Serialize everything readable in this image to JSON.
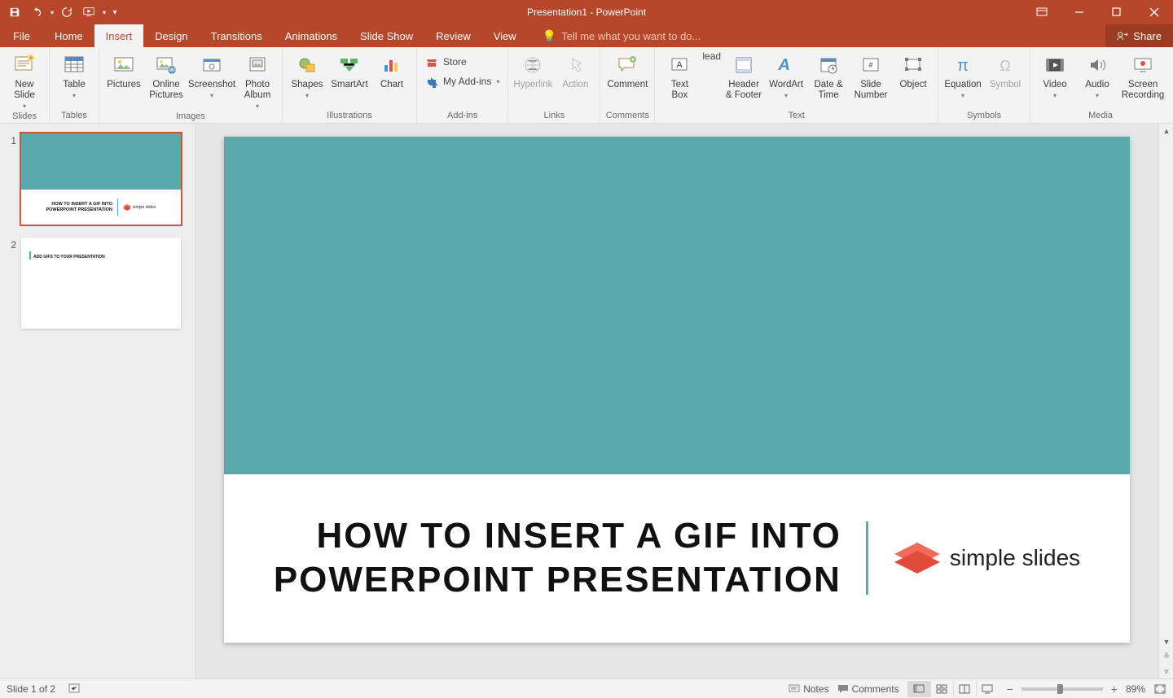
{
  "titlebar": {
    "title": "Presentation1 - PowerPoint"
  },
  "menu_tabs": {
    "file": "File",
    "home": "Home",
    "insert": "Insert",
    "design": "Design",
    "transitions": "Transitions",
    "animations": "Animations",
    "slideshow": "Slide Show",
    "review": "Review",
    "view": "View",
    "tellme": "Tell me what you want to do...",
    "share": "Share"
  },
  "ribbon": {
    "groups": {
      "slides": "Slides",
      "tables": "Tables",
      "images": "Images",
      "illustrations": "Illustrations",
      "addins": "Add-ins",
      "links": "Links",
      "comments": "Comments",
      "text": "Text",
      "symbols": "Symbols",
      "media": "Media"
    },
    "buttons": {
      "new_slide": "New\nSlide",
      "table": "Table",
      "pictures": "Pictures",
      "online_pictures": "Online\nPictures",
      "screenshot": "Screenshot",
      "photo_album": "Photo\nAlbum",
      "shapes": "Shapes",
      "smartart": "SmartArt",
      "chart": "Chart",
      "store": "Store",
      "my_addins": "My Add-ins",
      "hyperlink": "Hyperlink",
      "action": "Action",
      "comment": "Comment",
      "text_box": "Text\nBox",
      "header_footer": "Header\n& Footer",
      "wordart": "WordArt",
      "date_time": "Date &\nTime",
      "slide_number": "Slide\nNumber",
      "object": "Object",
      "equation": "Equation",
      "symbol": "Symbol",
      "video": "Video",
      "audio": "Audio",
      "screen_recording": "Screen\nRecording"
    }
  },
  "thumbs": {
    "n1": "1",
    "n2": "2",
    "thumb1_title": "HOW TO INSERT A GIF INTO\nPOWERPOINT PRESENTATION",
    "thumb1_logo": "simple slides",
    "thumb2_title": "ADD GIFS TO YOUR PRESENTATION"
  },
  "slide": {
    "title_l1": "HOW TO INSERT A GIF INTO",
    "title_l2": "POWERPOINT PRESENTATION",
    "logo_text": "simple slides"
  },
  "statusbar": {
    "slide_info": "Slide 1 of 2",
    "notes": "Notes",
    "comments": "Comments",
    "zoom": "89%"
  }
}
